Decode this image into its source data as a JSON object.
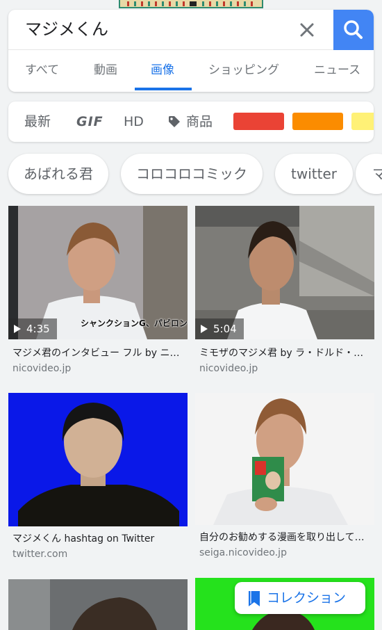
{
  "search": {
    "query": "マジメくん"
  },
  "tabs": [
    {
      "label": "すべて",
      "active": false
    },
    {
      "label": "動画",
      "active": false
    },
    {
      "label": "画像",
      "active": true
    },
    {
      "label": "ショッピング",
      "active": false
    },
    {
      "label": "ニュース",
      "active": false
    }
  ],
  "filters": {
    "latest": "最新",
    "gif": "GIF",
    "hd": "HD",
    "products": "商品",
    "color_swatches": [
      "#ea4335",
      "#fb8c00",
      "#fff176"
    ]
  },
  "related_chips": [
    {
      "label": "あばれる君"
    },
    {
      "label": "コロコロコミック"
    },
    {
      "label": "twitter"
    },
    {
      "label": "マ"
    }
  ],
  "results": [
    {
      "title": "マジメ君のインタビュー フル by ニコニ…",
      "source": "nicovideo.jp",
      "duration": "4:35",
      "overlay_caption": "シャンクションG、パビロン",
      "background": "#8f8a86"
    },
    {
      "title": "ミモザのマジメ君 by ラ・ドルド・ド…",
      "source": "nicovideo.jp",
      "duration": "5:04",
      "background": "#7c7a76"
    },
    {
      "title": "マジメくん hashtag on Twitter",
      "source": "twitter.com",
      "background": "#0a18e8"
    },
    {
      "title": "自分のお勧めする漫画を取り出して…",
      "source": "seiga.nicovideo.jp",
      "background": "#f4f4f4"
    },
    {
      "background": "#6b6e70"
    },
    {
      "background": "#25e21c"
    }
  ],
  "collection_button": {
    "label": "コレクション"
  },
  "colors": {
    "accent": "#1a73e8",
    "search_button": "#4285f4",
    "page_background": "#f1f3f4"
  }
}
